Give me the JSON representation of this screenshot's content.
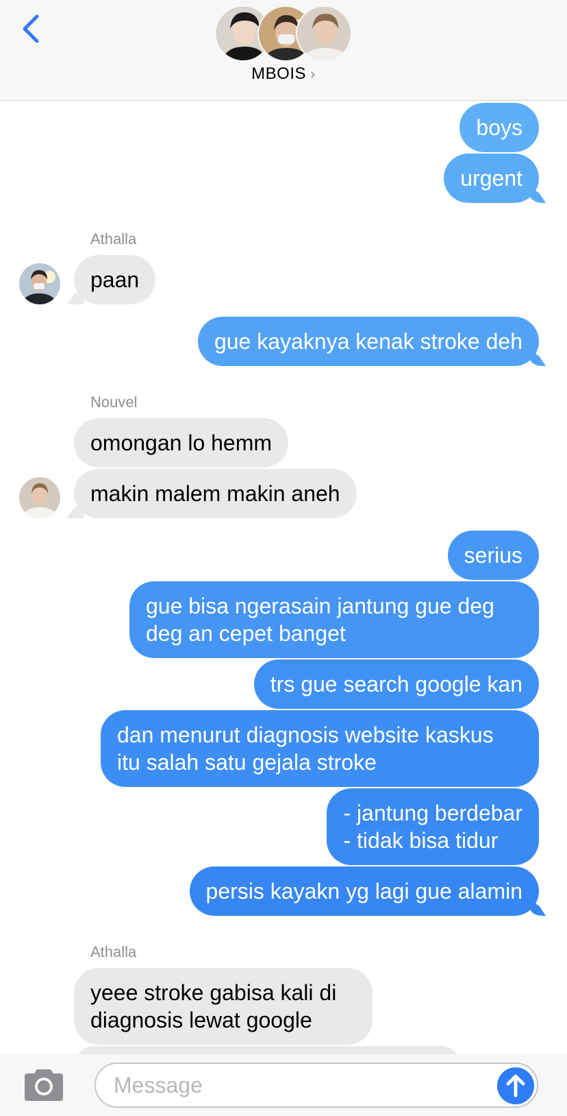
{
  "header": {
    "group_name": "MBOIS",
    "chevron": "›",
    "back_icon": "chevron-left-icon",
    "accent": "#3478f6"
  },
  "messages": [
    {
      "side": "out",
      "text": "boys"
    },
    {
      "side": "out",
      "text": "urgent"
    },
    {
      "side": "in",
      "sender": "Athalla",
      "text": "paan"
    },
    {
      "side": "out",
      "text": "gue kayaknya kenak stroke deh"
    },
    {
      "side": "in",
      "sender": "Nouvel",
      "text": "omongan lo hemm"
    },
    {
      "side": "in",
      "text": "makin malem makin aneh"
    },
    {
      "side": "out",
      "text": "serius"
    },
    {
      "side": "out",
      "text": "gue bisa ngerasain jantung gue deg deg an cepet banget"
    },
    {
      "side": "out",
      "text": "trs gue search google kan"
    },
    {
      "side": "out",
      "text": "dan menurut diagnosis website kaskus itu salah satu gejala stroke"
    },
    {
      "side": "out",
      "text": "- jantung berdebar\n- tidak bisa tidur"
    },
    {
      "side": "out",
      "text": "persis kayakn yg lagi gue alamin"
    },
    {
      "side": "in",
      "sender": "Athalla",
      "text": "yeee stroke gabisa kali di diagnosis lewat google"
    }
  ],
  "colors": {
    "outgoing_top": "#5fb0f7",
    "outgoing_bottom": "#2d7ef2",
    "incoming": "#e9e9eb"
  },
  "input": {
    "placeholder": "Message",
    "camera_icon": "camera-icon",
    "send_icon": "arrow-up-icon"
  }
}
